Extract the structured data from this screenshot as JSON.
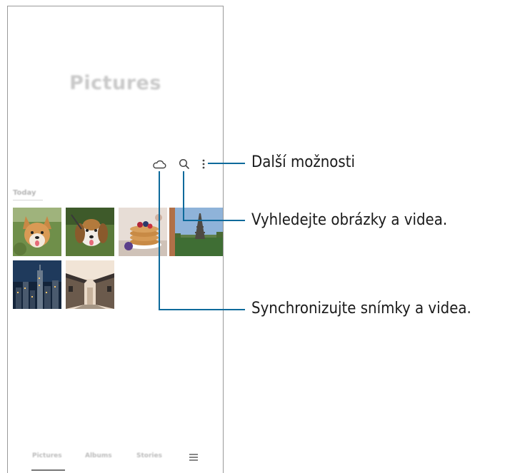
{
  "app": {
    "title": "Pictures"
  },
  "toolbar": {
    "icons": [
      "cloud-icon",
      "search-icon",
      "more-options-icon"
    ]
  },
  "gallery": {
    "section_label": "Today",
    "items": [
      {
        "name": "corgi-photo"
      },
      {
        "name": "beagle-photo"
      },
      {
        "name": "pancakes-photo"
      },
      {
        "name": "eiffel-tower-photo"
      },
      {
        "name": "city-night-photo"
      },
      {
        "name": "village-street-photo"
      }
    ]
  },
  "bottom_nav": {
    "tabs": [
      {
        "label": "Pictures",
        "active": true
      },
      {
        "label": "Albums",
        "active": false
      },
      {
        "label": "Stories",
        "active": false
      }
    ],
    "menu_icon": "menu-icon"
  },
  "callouts": {
    "more_options": "Další možnosti",
    "search": "Vyhledejte obrázky a videa.",
    "sync": "Synchronizujte snímky a videa."
  },
  "colors": {
    "callout_line": "#0d6a9b",
    "title_blurred": "#c9c9c9"
  }
}
